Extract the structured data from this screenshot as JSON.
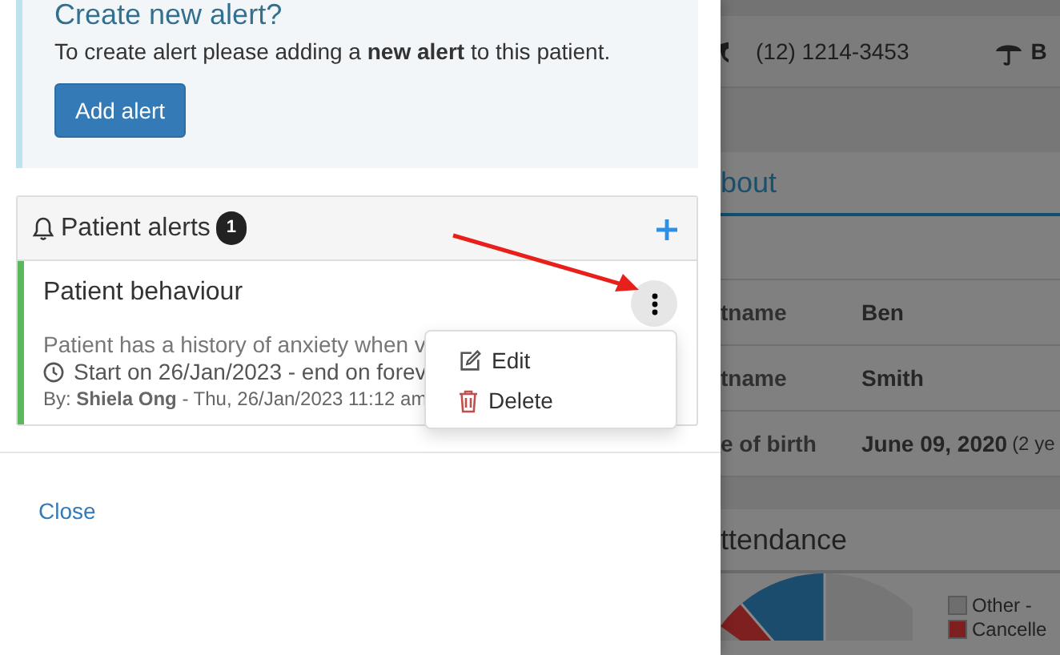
{
  "alert_prompt": {
    "title": "Create new alert?",
    "text": "To create alert please adding a **new alert** to this patient.",
    "button": "Add alert"
  },
  "alerts_panel": {
    "title": "Patient alerts",
    "count": "1"
  },
  "alerts": [
    {
      "title": "Patient behaviour",
      "color": "#5cb85c",
      "description": "Patient has a history of anxiety when v",
      "period": "Start on 26/Jan/2023 - end on forev",
      "author_line": "By: **Shiela Ong** - Thu, 26/Jan/2023 11:12 am",
      "menu_open": true
    }
  ],
  "menu": [
    {
      "label": "Edit",
      "kind": "edit"
    },
    {
      "label": "Delete",
      "kind": "delete"
    }
  ],
  "footer": {
    "close": "Close"
  },
  "background": {
    "phone": "(12) 1214-3453",
    "cut_label": "B",
    "tab": {
      "label": "bout",
      "selected": true
    },
    "fields": [
      {
        "label": "tname",
        "value": "Ben"
      },
      {
        "label": "tname",
        "value": "Smith"
      },
      {
        "label": "e of birth",
        "value": "June 09, 2020",
        "note": "(2 ye"
      }
    ],
    "section": "ttendance",
    "legend": [
      {
        "label": "Other - ",
        "color": "#6e6e6e"
      },
      {
        "label": "Cancelle",
        "color": "#7e2020"
      }
    ]
  }
}
